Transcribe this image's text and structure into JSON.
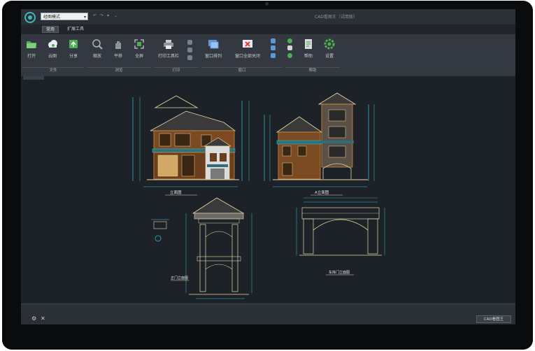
{
  "window": {
    "mode_select": "经图模式",
    "quick_access": [
      "↶",
      "↷",
      "▾",
      "⌄"
    ],
    "app_title": "CAD看图王（试用版）"
  },
  "tabs": [
    {
      "label": "常用",
      "active": true
    },
    {
      "label": "扩展工具",
      "active": false
    }
  ],
  "ribbon": {
    "buttons": [
      {
        "label": "打开",
        "icon": "folder-open-icon"
      },
      {
        "label": "云图",
        "icon": "cloud-icon"
      },
      {
        "label": "分享",
        "icon": "share-icon"
      },
      {
        "label": "缩放",
        "icon": "zoom-icon"
      },
      {
        "label": "平移",
        "icon": "hand-pan-icon"
      },
      {
        "label": "全屏",
        "icon": "fullscreen-icon"
      },
      {
        "label": "打印工具栏",
        "icon": "print-icon"
      },
      {
        "label": "窗口排列",
        "icon": "window-arrange-icon"
      },
      {
        "label": "窗口全部关闭",
        "icon": "close-all-windows-icon"
      },
      {
        "label": "帮助",
        "icon": "help-book-icon"
      },
      {
        "label": "设置",
        "icon": "settings-gear-icon"
      }
    ],
    "groups": [
      "文件",
      "浏览",
      "打印",
      "窗口",
      "帮助"
    ]
  },
  "drawing": {
    "captions": [
      "立面图",
      "A立面图",
      "正门立面图",
      "车库门立面图"
    ]
  },
  "status": {
    "brand": "CAD看图王"
  },
  "colors": {
    "canvas": "#1d2228",
    "cad_line": "#e8d9a6",
    "cad_dim": "#35c6d0",
    "cad_accent": "#d88a3a"
  }
}
